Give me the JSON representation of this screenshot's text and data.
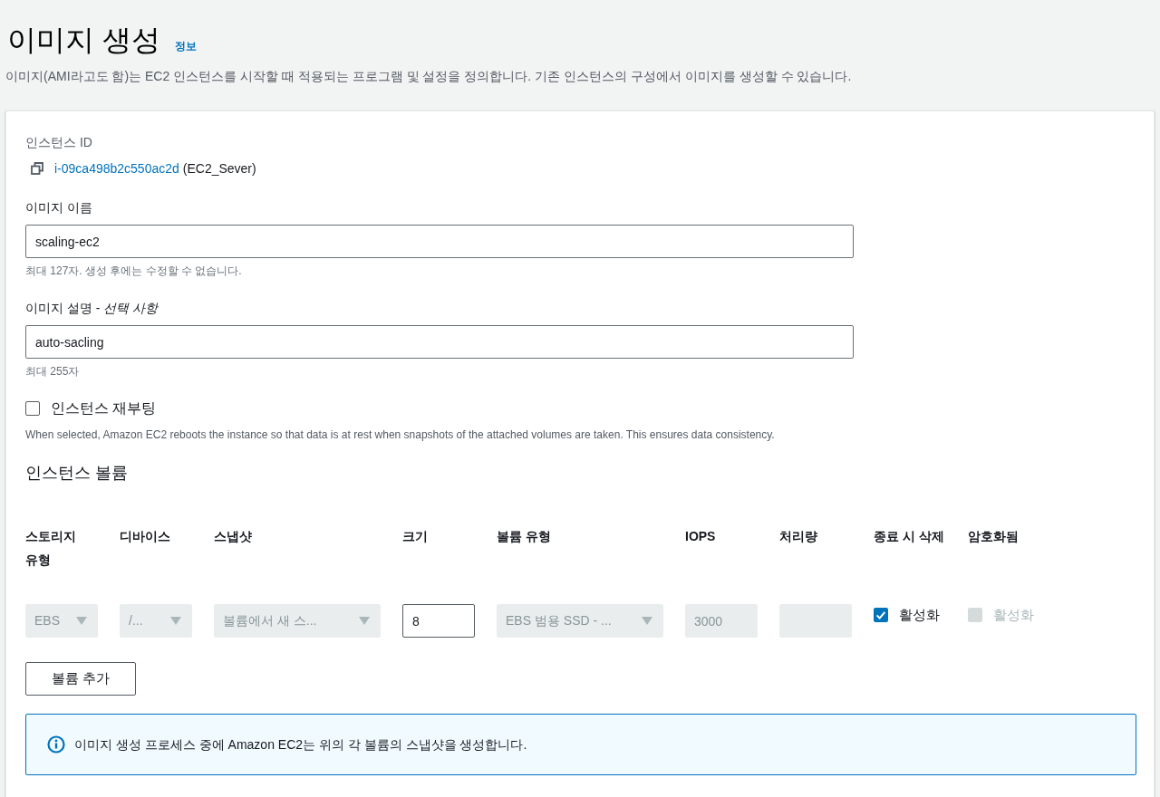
{
  "page": {
    "title": "이미지 생성",
    "info_link": "정보",
    "description": "이미지(AMI라고도 함)는 EC2 인스턴스를 시작할 때 적용되는 프로그램 및 설정을 정의합니다. 기존 인스턴스의 구성에서 이미지를 생성할 수 있습니다."
  },
  "instance": {
    "label": "인스턴스 ID",
    "id": "i-09ca498b2c550ac2d",
    "name": "(EC2_Sever)"
  },
  "fields": [
    {
      "label": "이미지 이름",
      "value": "scaling-ec2",
      "hint": "최대 127자. 생성 후에는 수정할 수 없습니다."
    },
    {
      "label": "이미지 설명 - *선택 사항*",
      "value": "auto-sacling",
      "hint": "최대 255자"
    }
  ],
  "reboot": {
    "label": "인스턴스 재부팅",
    "checked": false,
    "description": "When selected, Amazon EC2 reboots the instance so that data is at rest when snapshots of the attached volumes are taken. This ensures data consistency."
  },
  "volumes": {
    "heading": "인스턴스 볼륨",
    "columns": [
      "스토리지 유형",
      "디바이스",
      "스냅샷",
      "크기",
      "볼륨 유형",
      "IOPS",
      "처리량",
      "종료 시 삭제",
      "암호화됨"
    ],
    "rows": [
      {
        "cells": [
          {
            "kind": "select",
            "value": "EBS",
            "disabled": true
          },
          {
            "kind": "select",
            "value": "/...",
            "disabled": true
          },
          {
            "kind": "select",
            "value": "볼륨에서 새 스...",
            "disabled": true
          },
          {
            "kind": "input",
            "value": "8",
            "disabled": false
          },
          {
            "kind": "select",
            "value": "EBS 범용 SSD - ...",
            "disabled": true
          },
          {
            "kind": "input",
            "value": "3000",
            "disabled": true
          },
          {
            "kind": "input",
            "disabled": true
          },
          {
            "kind": "checkbox",
            "label": "활성화",
            "checked": true,
            "disabled": false
          },
          {
            "kind": "checkbox",
            "label": "활성화",
            "checked": false,
            "disabled": true
          }
        ]
      }
    ],
    "add_button": "볼륨 추가"
  },
  "alert": {
    "text": "이미지 생성 프로세스 중에 Amazon EC2는 위의 각 볼륨의 스냅샷을 생성합니다."
  }
}
